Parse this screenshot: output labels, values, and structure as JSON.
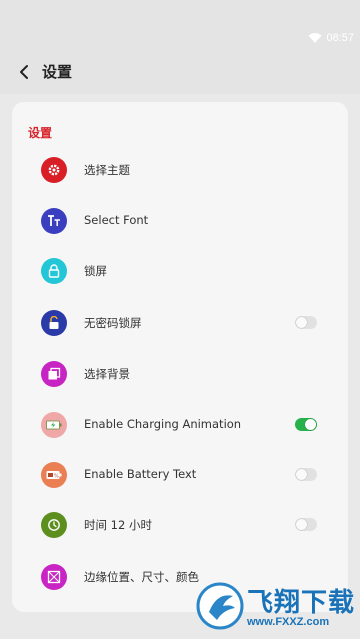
{
  "status_bar": {
    "time": "08:57"
  },
  "header": {
    "title": "设置"
  },
  "section": {
    "title": "设置"
  },
  "settings": [
    {
      "label": "选择主题",
      "icon": "gear-icon",
      "color": "#d81f26"
    },
    {
      "label": "Select Font",
      "icon": "font-icon",
      "color": "#3a3fbf"
    },
    {
      "label": "锁屏",
      "icon": "lock-icon",
      "color": "#22c6d6"
    },
    {
      "label": "无密码锁屏",
      "icon": "unlock-icon",
      "color": "#2a3aa8",
      "toggle": false
    },
    {
      "label": "选择背景",
      "icon": "layers-icon",
      "color": "#c724c4"
    },
    {
      "label": "Enable Charging Animation",
      "icon": "battery-charging-icon",
      "color": "#f0a7a7",
      "toggle": true
    },
    {
      "label": "Enable Battery Text",
      "icon": "battery-text-icon",
      "color": "#e97f52",
      "toggle": false
    },
    {
      "label": "时间 12 小时",
      "icon": "clock-icon",
      "color": "#5d8f1f",
      "toggle": false
    },
    {
      "label": "边缘位置、尺寸、颜色",
      "icon": "frame-icon",
      "color": "#c825c4"
    }
  ],
  "watermark": {
    "text": "飞翔下载",
    "url": "www.FXXZ.com"
  }
}
